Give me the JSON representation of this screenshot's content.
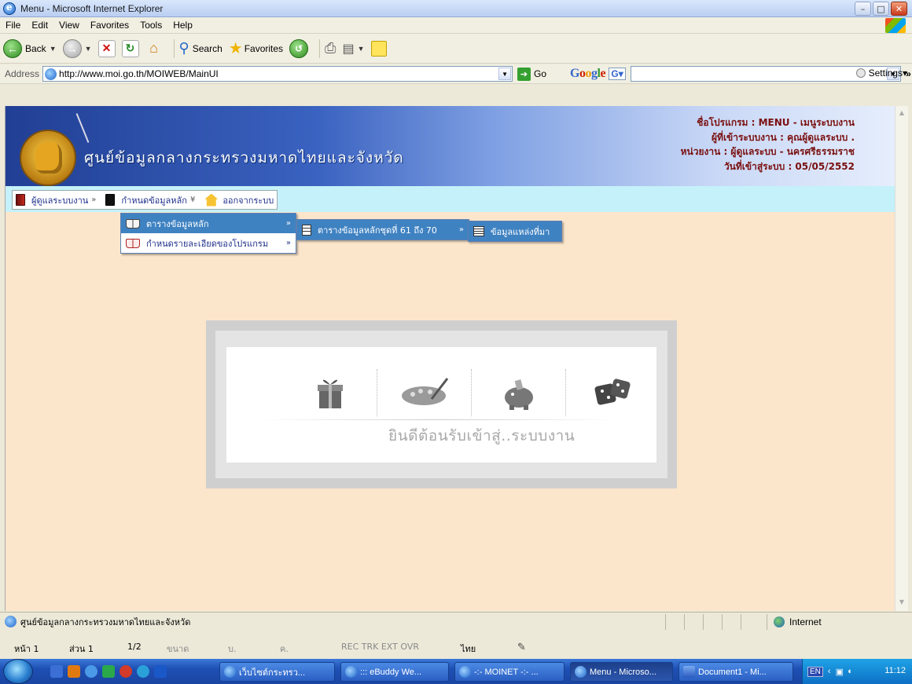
{
  "window": {
    "title": "Menu - Microsoft Internet Explorer",
    "minimize": "–",
    "maximize": "□",
    "close": "✕"
  },
  "menubar": {
    "items": [
      "File",
      "Edit",
      "View",
      "Favorites",
      "Tools",
      "Help"
    ]
  },
  "toolbar": {
    "back_label": "Back",
    "search_label": "Search",
    "favorites_label": "Favorites"
  },
  "address": {
    "label": "Address",
    "url": "http://www.moi.go.th/MOIWEB/MainUI",
    "go_label": "Go",
    "google_label": "Google",
    "google_button": "G▾",
    "more": "»",
    "settings_label": "Settings▾"
  },
  "page": {
    "banner_title": "ศูนย์ข้อมูลกลางกระทรวงมหาดไทยและจังหวัด",
    "info_lines": [
      "ชื่อโปรแกรม : MENU - เมนูระบบงาน",
      "ผู้ที่เข้าระบบงาน : คุณผู้ดูแลระบบ .",
      "หน่วยงาน : ผู้ดูแลระบบ - นครศรีธรรมราช",
      "วันที่เข้าสู่ระบบ : 05/05/2552"
    ],
    "top_menu": [
      {
        "label": "ผู้ดูแลระบบงาน",
        "chevron": "»"
      },
      {
        "label": "กำหนดข้อมูลหลัก",
        "chevron": "¥"
      },
      {
        "label": "ออกจากระบบ"
      }
    ],
    "submenu1": [
      {
        "label": "ตารางข้อมูลหลัก",
        "chevron": "»"
      },
      {
        "label": "กำหนดรายละเอียดของโปรแกรม",
        "chevron": "»"
      }
    ],
    "submenu2": [
      {
        "label": "ตารางข้อมูลหลักชุดที่ 61 ถึง 70",
        "chevron": "»"
      }
    ],
    "submenu3": [
      {
        "label": "ข้อมูลแหล่งที่มา"
      }
    ],
    "welcome_text": "ยินดีต้อนรับเข้าสู่..ระบบงาน"
  },
  "statusbar": {
    "text": "ศูนย์ข้อมูลกลางกระทรวงมหาดไทยและจังหวัด",
    "zone": "Internet"
  },
  "wordbar": {
    "page": "หน้า 1",
    "section": "ส่วน 1",
    "pages": "1/2",
    "size": "ขนาด",
    "line": "บ.",
    "col": "ค.",
    "modes": "REC  TRK  EXT  OVR",
    "language": "ไทย"
  },
  "taskbar": {
    "tasks": [
      "เว็บไซต์กระทรว...",
      "::: eBuddy We...",
      "-:- MOINET -:- ...",
      "Menu - Microso...",
      "Document1 - Mi..."
    ],
    "lang": "EN",
    "clock": "11:12"
  },
  "colors": {
    "menu_highlight": "#3f82c2",
    "banner_info": "#7a1010",
    "page_bg": "#fbe6cc",
    "menu_row_bg": "#c5f1fa"
  }
}
